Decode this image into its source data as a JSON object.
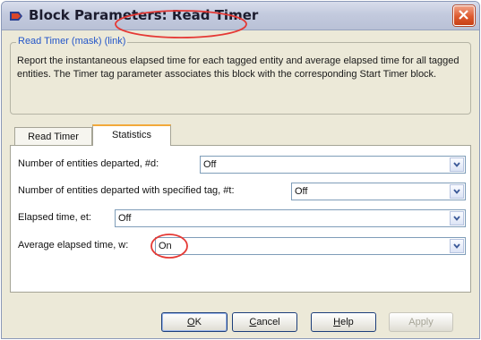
{
  "window": {
    "title": "Block Parameters: Read Timer"
  },
  "mask_group": {
    "title": "Read Timer (mask) (link)",
    "description": "Report the instantaneous elapsed time for each tagged entity and average elapsed time for all tagged entities. The Timer tag parameter associates this block with the corresponding Start Timer block."
  },
  "tabs": [
    {
      "label": "Read Timer",
      "active": false
    },
    {
      "label": "Statistics",
      "active": true
    }
  ],
  "parameters": [
    {
      "label": "Number of entities departed, #d:",
      "value": "Off"
    },
    {
      "label": "Number of entities departed with specified tag, #t:",
      "value": "Off"
    },
    {
      "label": "Elapsed time, et:",
      "value": "Off"
    },
    {
      "label": "Average elapsed time, w:",
      "value": "On"
    }
  ],
  "buttons": {
    "ok": {
      "mnemonic": "O",
      "rest": "K"
    },
    "cancel": {
      "mnemonic": "C",
      "rest": "ancel"
    },
    "help": {
      "mnemonic": "H",
      "rest": "elp"
    },
    "apply": {
      "label": "Apply",
      "enabled": false
    }
  },
  "colors": {
    "annotation_circle": "#e53935",
    "active_tab_accent": "#f2a93b",
    "group_title": "#2456c9",
    "close_button": "#dd5a2f"
  },
  "icons": {
    "app": "simulink-block-icon",
    "close": "close-x-icon",
    "dropdown": "chevron-down-icon"
  }
}
